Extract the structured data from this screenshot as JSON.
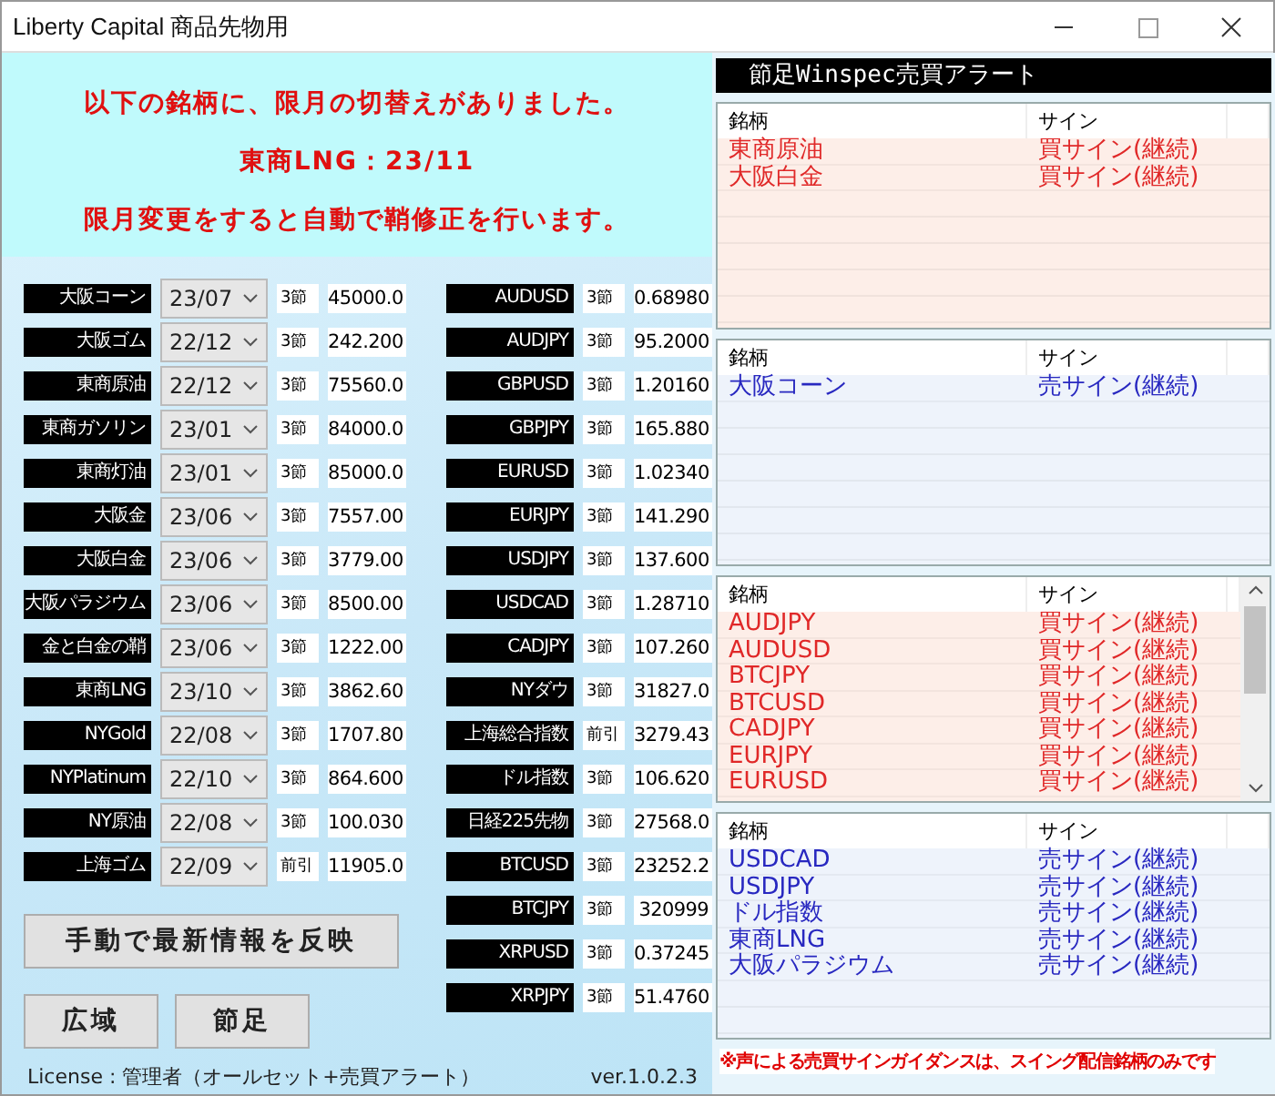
{
  "window": {
    "title": "Liberty Capital 商品先物用"
  },
  "notice": {
    "lines": [
      "以下の銘柄に、限月の切替えがありました。",
      "東商LNG：23/11",
      "限月変更をすると自動で鞘修正を行います。"
    ]
  },
  "commodities": [
    {
      "name": "大阪コーン",
      "month": "23/07",
      "session": "3節",
      "price": "45000.0"
    },
    {
      "name": "大阪ゴム",
      "month": "22/12",
      "session": "3節",
      "price": "242.200"
    },
    {
      "name": "東商原油",
      "month": "22/12",
      "session": "3節",
      "price": "75560.0"
    },
    {
      "name": "東商ガソリン",
      "month": "23/01",
      "session": "3節",
      "price": "84000.0"
    },
    {
      "name": "東商灯油",
      "month": "23/01",
      "session": "3節",
      "price": "85000.0"
    },
    {
      "name": "大阪金",
      "month": "23/06",
      "session": "3節",
      "price": "7557.00"
    },
    {
      "name": "大阪白金",
      "month": "23/06",
      "session": "3節",
      "price": "3779.00"
    },
    {
      "name": "大阪パラジウム",
      "month": "23/06",
      "session": "3節",
      "price": "8500.00"
    },
    {
      "name": "金と白金の鞘",
      "month": "23/06",
      "session": "3節",
      "price": "1222.00"
    },
    {
      "name": "東商LNG",
      "month": "23/10",
      "session": "3節",
      "price": "3862.60"
    },
    {
      "name": "NYGold",
      "month": "22/08",
      "session": "3節",
      "price": "1707.80"
    },
    {
      "name": "NYPlatinum",
      "month": "22/10",
      "session": "3節",
      "price": "864.600"
    },
    {
      "name": "NY原油",
      "month": "22/08",
      "session": "3節",
      "price": "100.030"
    },
    {
      "name": "上海ゴム",
      "month": "22/09",
      "session": "前引",
      "price": "11905.0"
    }
  ],
  "markets": [
    {
      "name": "AUDUSD",
      "session": "3節",
      "price": "0.68980"
    },
    {
      "name": "AUDJPY",
      "session": "3節",
      "price": "95.2000"
    },
    {
      "name": "GBPUSD",
      "session": "3節",
      "price": "1.20160"
    },
    {
      "name": "GBPJPY",
      "session": "3節",
      "price": "165.880"
    },
    {
      "name": "EURUSD",
      "session": "3節",
      "price": "1.02340"
    },
    {
      "name": "EURJPY",
      "session": "3節",
      "price": "141.290"
    },
    {
      "name": "USDJPY",
      "session": "3節",
      "price": "137.600"
    },
    {
      "name": "USDCAD",
      "session": "3節",
      "price": "1.28710"
    },
    {
      "name": "CADJPY",
      "session": "3節",
      "price": "107.260"
    },
    {
      "name": "NYダウ",
      "session": "3節",
      "price": "31827.0"
    },
    {
      "name": "上海総合指数",
      "session": "前引",
      "price": "3279.43"
    },
    {
      "name": "ドル指数",
      "session": "3節",
      "price": "106.620"
    },
    {
      "name": "日経225先物",
      "session": "3節",
      "price": "27568.0"
    },
    {
      "name": "BTCUSD",
      "session": "3節",
      "price": "23252.2"
    },
    {
      "name": "BTCJPY",
      "session": "3節",
      "price": "320999"
    },
    {
      "name": "XRPUSD",
      "session": "3節",
      "price": "0.37245"
    },
    {
      "name": "XRPJPY",
      "session": "3節",
      "price": "51.4760"
    }
  ],
  "buttons": {
    "refresh": "手動で最新情報を反映",
    "wide": "広域",
    "bar": "節足"
  },
  "license": "License : 管理者（オールセット+売買アラート）",
  "version": "ver.1.0.2.3",
  "alerts": {
    "title": "節足Winspec売買アラート",
    "lists": [
      {
        "kind": "buy",
        "scrollable": false,
        "columns": [
          "銘柄",
          "サイン"
        ],
        "rows": [
          {
            "name": "東商原油",
            "sign": "買サイン(継続)"
          },
          {
            "name": "大阪白金",
            "sign": "買サイン(継続)"
          }
        ]
      },
      {
        "kind": "sell",
        "scrollable": false,
        "columns": [
          "銘柄",
          "サイン"
        ],
        "rows": [
          {
            "name": "大阪コーン",
            "sign": "売サイン(継続)"
          }
        ]
      },
      {
        "kind": "buy",
        "scrollable": true,
        "columns": [
          "銘柄",
          "サイン"
        ],
        "rows": [
          {
            "name": "AUDJPY",
            "sign": "買サイン(継続)"
          },
          {
            "name": "AUDUSD",
            "sign": "買サイン(継続)"
          },
          {
            "name": "BTCJPY",
            "sign": "買サイン(継続)"
          },
          {
            "name": "BTCUSD",
            "sign": "買サイン(継続)"
          },
          {
            "name": "CADJPY",
            "sign": "買サイン(継続)"
          },
          {
            "name": "EURJPY",
            "sign": "買サイン(継続)"
          },
          {
            "name": "EURUSD",
            "sign": "買サイン(継続)"
          }
        ]
      },
      {
        "kind": "sell",
        "scrollable": false,
        "columns": [
          "銘柄",
          "サイン"
        ],
        "rows": [
          {
            "name": "USDCAD",
            "sign": "売サイン(継続)"
          },
          {
            "name": "USDJPY",
            "sign": "売サイン(継続)"
          },
          {
            "name": "ドル指数",
            "sign": "売サイン(継続)"
          },
          {
            "name": "東商LNG",
            "sign": "売サイン(継続)"
          },
          {
            "name": "大阪パラジウム",
            "sign": "売サイン(継続)"
          }
        ]
      }
    ],
    "note": "※声による売買サインガイダンスは、スイング配信銘柄のみです"
  }
}
